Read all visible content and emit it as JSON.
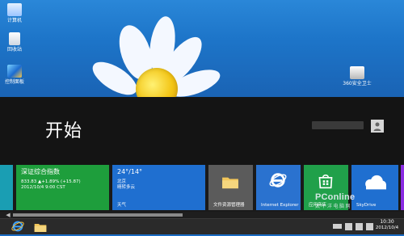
{
  "desktop": {
    "icons": [
      {
        "label": "计算机",
        "icon": "computer-icon"
      },
      {
        "label": "回收站",
        "icon": "recycle-bin-icon"
      },
      {
        "label": "控制面板",
        "icon": "control-panel-icon"
      },
      {
        "label": "360安全卫士",
        "icon": "app-shortcut-icon"
      }
    ]
  },
  "start": {
    "title": "开始",
    "user_name": "",
    "avatar_icon": "user-avatar-icon"
  },
  "tiles": [
    {
      "id": "stocks",
      "title": "深证综合指数",
      "lines": [
        "833.83 ▲+1.89% (+15.87)",
        "2012/10/4 9:00 CST"
      ],
      "color": "#1e9e3c"
    },
    {
      "id": "weather",
      "title": "24°/14°",
      "lines": [
        "北京",
        "晴转多云"
      ],
      "label": "天气",
      "color": "#1f6fd0"
    },
    {
      "id": "explorer",
      "label": "文件资源管理器",
      "color": "#5b5b5b",
      "icon": "folder-icon"
    },
    {
      "id": "ie",
      "label": "Internet Explorer",
      "color": "#2a72cf",
      "icon": "internet-explorer-icon"
    },
    {
      "id": "store",
      "label": "应用商店",
      "color": "#20a04a",
      "icon": "store-icon"
    },
    {
      "id": "skydrive",
      "label": "SkyDrive",
      "color": "#1f6fd0",
      "icon": "cloud-icon"
    }
  ],
  "taskbar": {
    "items": [
      {
        "name": "Internet Explorer",
        "icon": "internet-explorer-icon"
      },
      {
        "name": "文件资源管理器",
        "icon": "folder-icon"
      }
    ],
    "time": "10:30",
    "date": "2012/10/4"
  },
  "watermark": {
    "brand": "PConline",
    "subtitle": "太平洋电脑网"
  },
  "colors": {
    "accent": "#1f6fd0",
    "start_bg": "#141414",
    "taskbar_bg": "#2a2a2a"
  }
}
